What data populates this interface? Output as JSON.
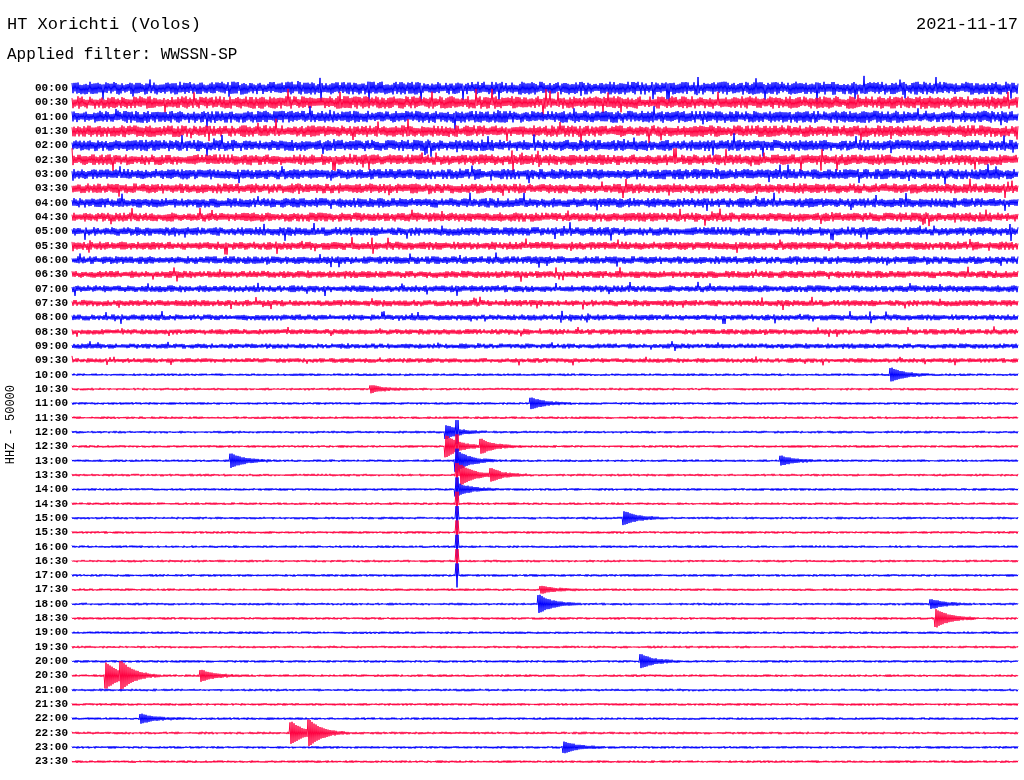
{
  "station": {
    "title": "HT Xorichti (Volos)",
    "date": "2021-11-17",
    "filter": "Applied filter: WWSSN-SP"
  },
  "channel_label": "HHZ - 50000",
  "traces": [
    {
      "time": "00:00",
      "color": "#0000ff"
    },
    {
      "time": "00:30",
      "color": "#ff0040"
    },
    {
      "time": "01:00",
      "color": "#0000ff"
    },
    {
      "time": "01:30",
      "color": "#ff0040"
    },
    {
      "time": "02:00",
      "color": "#0000ff"
    },
    {
      "time": "02:30",
      "color": "#ff0040"
    },
    {
      "time": "03:00",
      "color": "#0000ff"
    },
    {
      "time": "03:30",
      "color": "#ff0040"
    },
    {
      "time": "04:00",
      "color": "#0000ff"
    },
    {
      "time": "04:30",
      "color": "#ff0040"
    },
    {
      "time": "05:00",
      "color": "#0000ff"
    },
    {
      "time": "05:30",
      "color": "#ff0040"
    },
    {
      "time": "06:00",
      "color": "#0000ff"
    },
    {
      "time": "06:30",
      "color": "#ff0040"
    },
    {
      "time": "07:00",
      "color": "#0000ff"
    },
    {
      "time": "07:30",
      "color": "#ff0040"
    },
    {
      "time": "08:00",
      "color": "#0000ff"
    },
    {
      "time": "08:30",
      "color": "#ff0040"
    },
    {
      "time": "09:00",
      "color": "#0000ff"
    },
    {
      "time": "09:30",
      "color": "#ff0040"
    },
    {
      "time": "10:00",
      "color": "#0000ff"
    },
    {
      "time": "10:30",
      "color": "#ff0040"
    },
    {
      "time": "11:00",
      "color": "#0000ff"
    },
    {
      "time": "11:30",
      "color": "#ff0040"
    },
    {
      "time": "12:00",
      "color": "#0000ff"
    },
    {
      "time": "12:30",
      "color": "#ff0040"
    },
    {
      "time": "13:00",
      "color": "#0000ff"
    },
    {
      "time": "13:30",
      "color": "#ff0040"
    },
    {
      "time": "14:00",
      "color": "#0000ff"
    },
    {
      "time": "14:30",
      "color": "#ff0040"
    },
    {
      "time": "15:00",
      "color": "#0000ff"
    },
    {
      "time": "15:30",
      "color": "#ff0040"
    },
    {
      "time": "16:00",
      "color": "#0000ff"
    },
    {
      "time": "16:30",
      "color": "#ff0040"
    },
    {
      "time": "17:00",
      "color": "#0000ff"
    },
    {
      "time": "17:30",
      "color": "#ff0040"
    },
    {
      "time": "18:00",
      "color": "#0000ff"
    },
    {
      "time": "18:30",
      "color": "#ff0040"
    },
    {
      "time": "19:00",
      "color": "#0000ff"
    },
    {
      "time": "19:30",
      "color": "#ff0040"
    },
    {
      "time": "20:00",
      "color": "#0000ff"
    },
    {
      "time": "20:30",
      "color": "#ff0040"
    },
    {
      "time": "21:00",
      "color": "#0000ff"
    },
    {
      "time": "21:30",
      "color": "#ff0040"
    },
    {
      "time": "22:00",
      "color": "#0000ff"
    },
    {
      "time": "22:30",
      "color": "#ff0040"
    },
    {
      "time": "23:00",
      "color": "#0000ff"
    },
    {
      "time": "23:30",
      "color": "#ff0040"
    }
  ]
}
